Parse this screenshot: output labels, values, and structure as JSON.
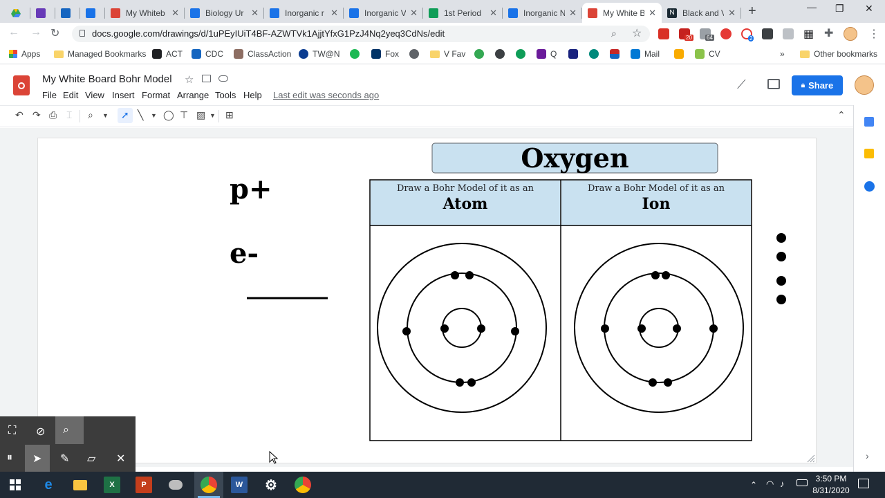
{
  "browser": {
    "tabs": [
      {
        "title": "",
        "icon": "google-drive-icon",
        "color": "#34a853"
      },
      {
        "title": "",
        "icon": "google-forms-icon",
        "color": "#673ab7"
      },
      {
        "title": "",
        "icon": "classroom-icon",
        "color": "#1565c0"
      },
      {
        "title": "",
        "icon": "google-docs-icon",
        "color": "#1a73e8"
      },
      {
        "title": "My Whiteb",
        "icon": "google-drawings-icon",
        "color": "#db4437"
      },
      {
        "title": "Biology Ur",
        "icon": "google-docs-icon",
        "color": "#1a73e8"
      },
      {
        "title": "Inorganic r",
        "icon": "google-docs-icon",
        "color": "#1a73e8"
      },
      {
        "title": "Inorganic V",
        "icon": "google-docs-icon",
        "color": "#1a73e8"
      },
      {
        "title": "1st Period",
        "icon": "classroom-icon",
        "color": "#0f9d58"
      },
      {
        "title": "Inorganic N",
        "icon": "google-docs-icon",
        "color": "#1a73e8"
      },
      {
        "title": "My White B",
        "icon": "google-drawings-icon",
        "color": "#db4437"
      },
      {
        "title": "Black and V",
        "icon": "n-icon",
        "color": "#1b2a33"
      }
    ],
    "url": "docs.google.com/drawings/d/1uPEyIUiT4BF-AZWTVk1AjjtYfxG1PzJ4Nq2yeq3CdNs/edit",
    "bookmarks": [
      {
        "label": "Apps",
        "icon": "apps-grid-icon"
      },
      {
        "label": "Managed Bookmarks",
        "icon": "folder-icon"
      },
      {
        "label": "ACT",
        "icon": "act-icon"
      },
      {
        "label": "CDC",
        "icon": "cdc-icon"
      },
      {
        "label": "ClassAction",
        "icon": "classaction-icon"
      },
      {
        "label": "TW@N",
        "icon": "nasa-icon"
      },
      {
        "label": "",
        "icon": "spotify-icon"
      },
      {
        "label": "Fox",
        "icon": "fox-icon"
      },
      {
        "label": "",
        "icon": "globe-icon"
      },
      {
        "label": "V Fav",
        "icon": "folder-icon"
      },
      {
        "label": "Q",
        "icon": "q-icon"
      },
      {
        "label": "Mail",
        "icon": "outlook-icon"
      },
      {
        "label": "CV",
        "icon": "cv-icon"
      },
      {
        "label": "Other bookmarks",
        "icon": "folder-icon"
      }
    ],
    "badges": {
      "ext1": "20",
      "ext2": "64",
      "ext3": "2"
    },
    "more_bookmarks": "»"
  },
  "docs": {
    "title": "My White Board Bohr Model",
    "menu": [
      "File",
      "Edit",
      "View",
      "Insert",
      "Format",
      "Arrange",
      "Tools",
      "Help"
    ],
    "last_edit": "Last edit was seconds ago",
    "share_label": "Share"
  },
  "slide": {
    "element_title": "Oxygen",
    "p_label": "p+",
    "e_label": "e-",
    "blank_line": "______",
    "col1_small": "Draw a Bohr Model of it as an",
    "col1_big": "Atom",
    "col2_small": "Draw a Bohr Model of it as an",
    "col2_big": "Ion",
    "header_fill": "#c9e1f0",
    "atom_model": {
      "inner_shell_electrons": 2,
      "outer_shell_electrons": 6
    },
    "ion_model": {
      "inner_shell_electrons": 2,
      "outer_shell_electrons": 6
    },
    "loose_electrons": 4
  },
  "taskbar": {
    "time": "3:50 PM",
    "date": "8/31/2020"
  },
  "recorder": {
    "tools": [
      "screenshot-icon",
      "webcam-off-icon",
      "zoom-icon",
      "pause-icon",
      "pointer-icon",
      "pen-icon",
      "eraser-icon",
      "close-icon"
    ]
  }
}
